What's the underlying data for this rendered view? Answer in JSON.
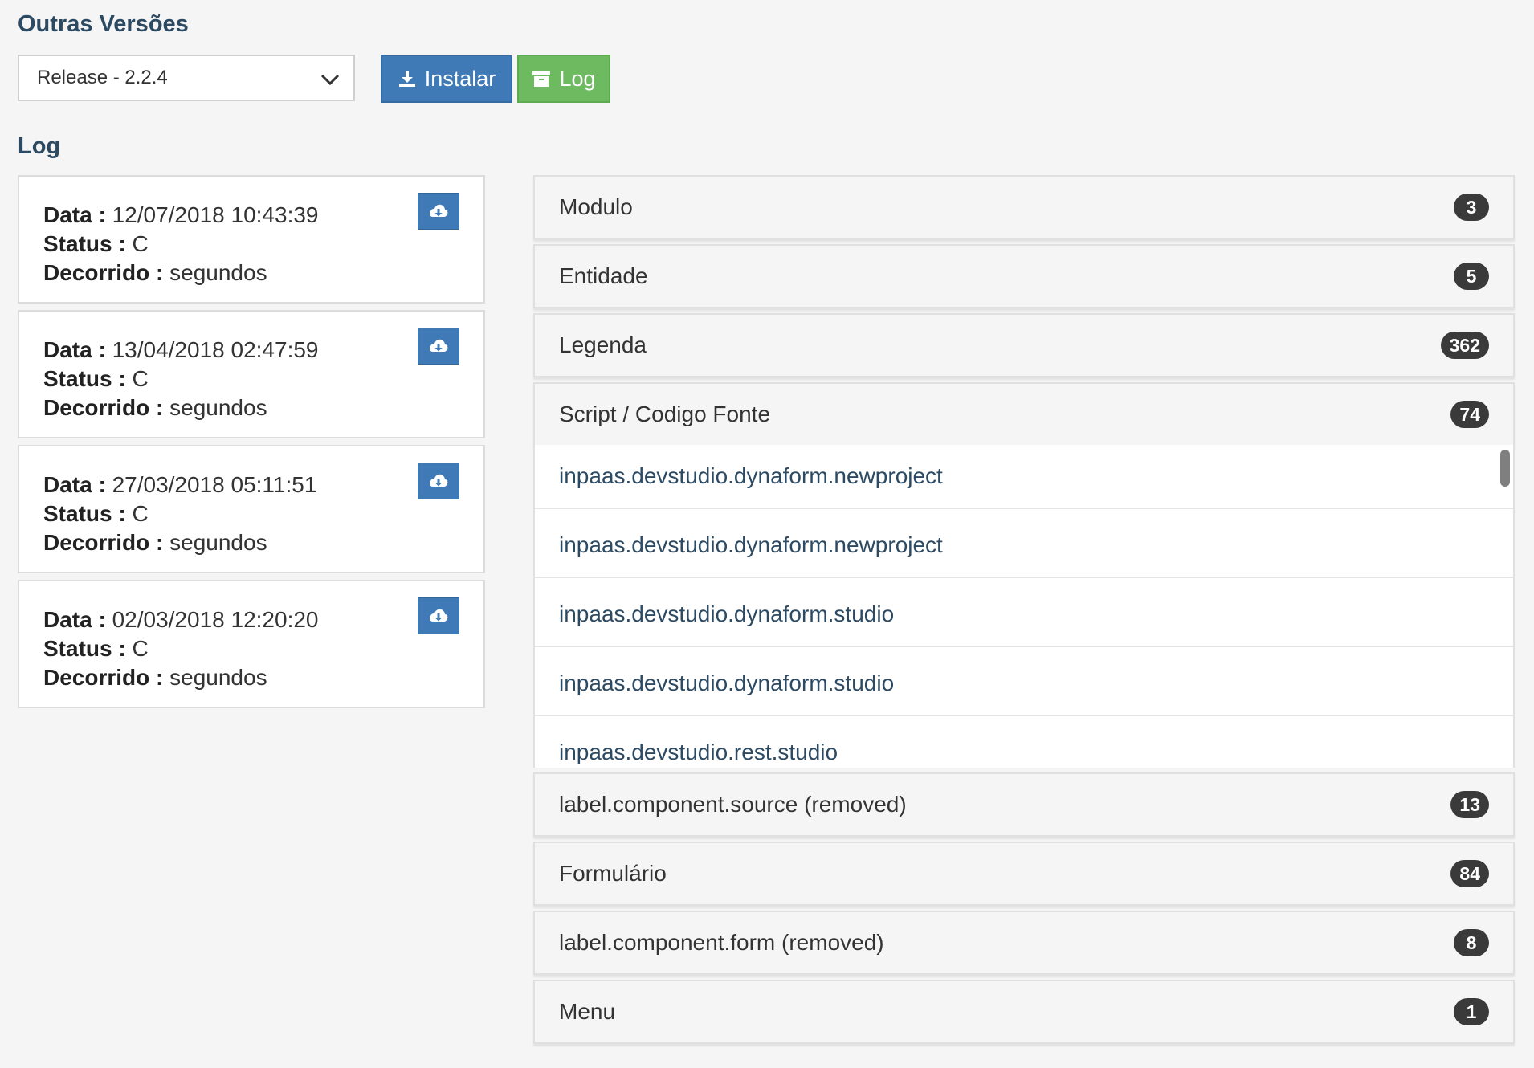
{
  "header": {
    "other_versions_title": "Outras Versões",
    "log_title": "Log"
  },
  "version_select": {
    "selected": "Release - 2.2.4"
  },
  "buttons": {
    "install": "Instalar",
    "log": "Log"
  },
  "labels": {
    "data": "Data :",
    "status": "Status :",
    "decorrido": "Decorrido :"
  },
  "logs": [
    {
      "data": "12/07/2018 10:43:39",
      "status": "C",
      "decorrido": "segundos"
    },
    {
      "data": "13/04/2018 02:47:59",
      "status": "C",
      "decorrido": "segundos"
    },
    {
      "data": "27/03/2018 05:11:51",
      "status": "C",
      "decorrido": "segundos"
    },
    {
      "data": "02/03/2018 12:20:20",
      "status": "C",
      "decorrido": "segundos"
    }
  ],
  "panels": [
    {
      "label": "Modulo",
      "count": "3"
    },
    {
      "label": "Entidade",
      "count": "5"
    },
    {
      "label": "Legenda",
      "count": "362"
    },
    {
      "label": "Script / Codigo Fonte",
      "count": "74"
    },
    {
      "label": "label.component.source (removed)",
      "count": "13"
    },
    {
      "label": "Formulário",
      "count": "84"
    },
    {
      "label": "label.component.form (removed)",
      "count": "8"
    },
    {
      "label": "Menu",
      "count": "1"
    }
  ],
  "script_items": [
    "inpaas.devstudio.dynaform.newproject",
    "inpaas.devstudio.dynaform.newproject",
    "inpaas.devstudio.dynaform.studio",
    "inpaas.devstudio.dynaform.studio",
    "inpaas.devstudio.rest.studio"
  ],
  "colors": {
    "primary": "#3f7ab6",
    "success": "#6dba60",
    "heading": "#2d4a63",
    "badge": "#3a3a3a"
  },
  "icons": {
    "install": "download-icon",
    "log": "archive-icon",
    "card_action": "cloud-download-icon",
    "select": "chevron-down-icon"
  }
}
